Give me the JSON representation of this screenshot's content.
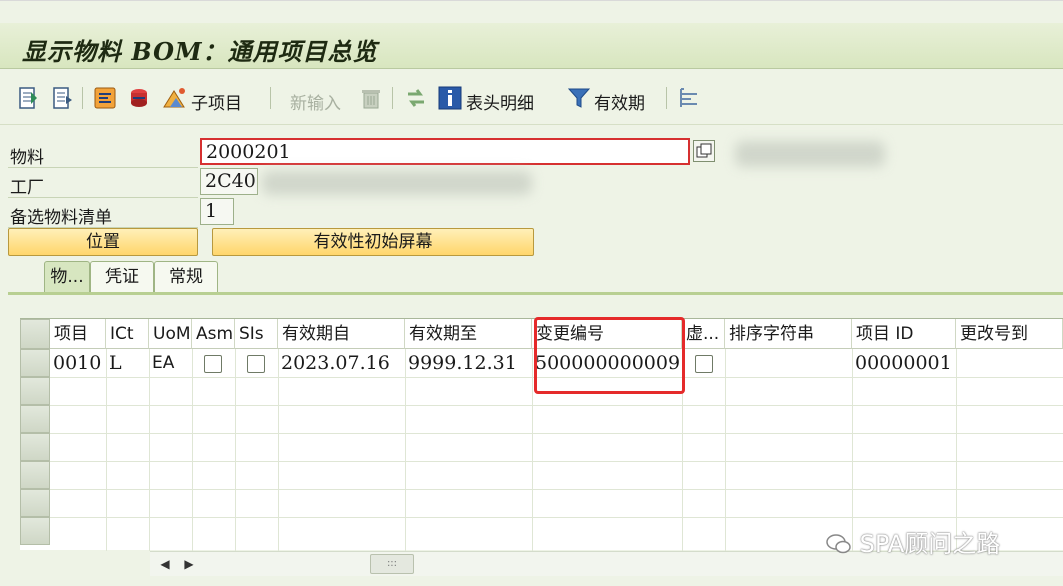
{
  "window": {
    "title": "显示物料 BOM：通用项目总览"
  },
  "toolbar": {
    "subitem_label": "子项目",
    "new_entry_label": "新输入",
    "header_detail_label": "表头明细",
    "validity_label": "有效期"
  },
  "header": {
    "material_label": "物料",
    "material_value": "2000201",
    "plant_label": "工厂",
    "plant_value": "2C40",
    "alt_bom_label": "备选物料清单",
    "alt_bom_value": "1"
  },
  "buttons": {
    "position": "位置",
    "validity_initial_screen": "有效性初始屏幕"
  },
  "tabs": [
    {
      "label": "物..."
    },
    {
      "label": "凭证"
    },
    {
      "label": "常规"
    }
  ],
  "table": {
    "columns": [
      "项目",
      "ICt",
      "UoM",
      "Asm",
      "SIs",
      "有效期自",
      "有效期至",
      "变更编号",
      "虚...",
      "排序字符串",
      "项目 ID",
      "更改号到"
    ],
    "rows": [
      {
        "item": "0010",
        "ict": "L",
        "uom": "EA",
        "asm": false,
        "sis": false,
        "valid_from": "2023.07.16",
        "valid_to": "9999.12.31",
        "change_number": "500000000009",
        "phantom": false,
        "sort_string": "",
        "item_id": "00000001",
        "change_to": ""
      }
    ]
  },
  "watermark": "SPA顾问之路"
}
